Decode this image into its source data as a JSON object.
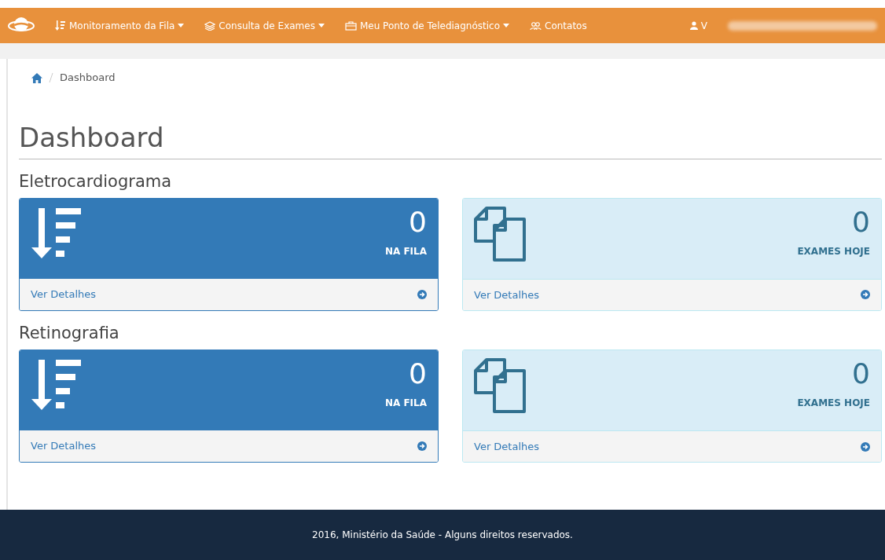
{
  "navbar": {
    "menus": [
      {
        "label": "Monitoramento da Fila",
        "dropdown": true
      },
      {
        "label": "Consulta de Exames",
        "dropdown": true
      },
      {
        "label": "Meu Ponto de Telediagnóstico",
        "dropdown": true
      },
      {
        "label": "Contatos",
        "dropdown": false
      }
    ],
    "user": "V"
  },
  "breadcrumb": [
    "Dashboard"
  ],
  "page_title": "Dashboard",
  "sections": [
    {
      "title": "Eletrocardiograma",
      "panels": [
        {
          "kind": "queue",
          "value": "0",
          "label": "NA FILA",
          "link": "Ver Detalhes"
        },
        {
          "kind": "exams",
          "value": "0",
          "label": "EXAMES HOJE",
          "link": "Ver Detalhes"
        }
      ]
    },
    {
      "title": "Retinografia",
      "panels": [
        {
          "kind": "queue",
          "value": "0",
          "label": "NA FILA",
          "link": "Ver Detalhes"
        },
        {
          "kind": "exams",
          "value": "0",
          "label": "EXAMES HOJE",
          "link": "Ver Detalhes"
        }
      ]
    }
  ],
  "footer": "2016, Ministério da Saúde - Alguns direitos reservados."
}
